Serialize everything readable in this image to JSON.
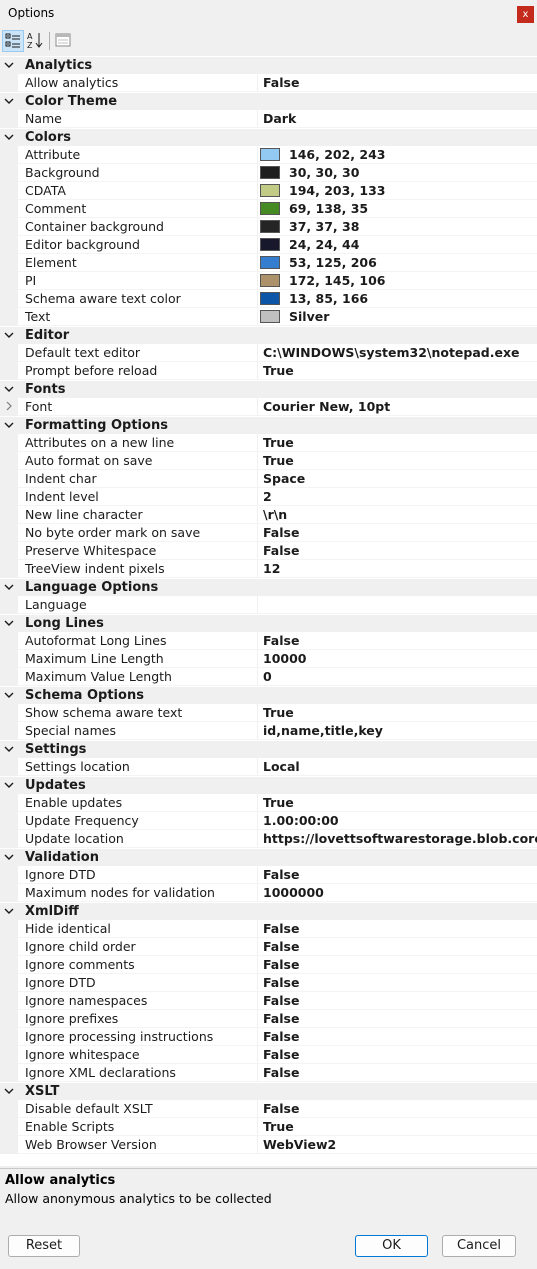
{
  "window": {
    "title": "Options",
    "close_glyph": "x"
  },
  "toolbar": {
    "buttons": [
      {
        "name": "categorized-view-icon",
        "active": true
      },
      {
        "name": "alphabetical-sort-icon",
        "active": false
      },
      {
        "name": "property-pages-icon",
        "active": false
      }
    ]
  },
  "grid": {
    "categories": [
      {
        "label": "Analytics",
        "props": [
          {
            "name": "Allow analytics",
            "value": "False"
          }
        ]
      },
      {
        "label": "Color Theme",
        "props": [
          {
            "name": "Name",
            "value": "Dark"
          }
        ]
      },
      {
        "label": "Colors",
        "props": [
          {
            "name": "Attribute",
            "value": "146, 202, 243",
            "color": "#92caf3"
          },
          {
            "name": "Background",
            "value": "30, 30, 30",
            "color": "#1e1e1e"
          },
          {
            "name": "CDATA",
            "value": "194, 203, 133",
            "color": "#c2cb85"
          },
          {
            "name": "Comment",
            "value": "69, 138, 35",
            "color": "#458a23"
          },
          {
            "name": "Container background",
            "value": "37, 37, 38",
            "color": "#252526"
          },
          {
            "name": "Editor background",
            "value": "24, 24, 44",
            "color": "#18182c"
          },
          {
            "name": "Element",
            "value": "53, 125, 206",
            "color": "#357dce"
          },
          {
            "name": "PI",
            "value": "172, 145, 106",
            "color": "#ac916a"
          },
          {
            "name": "Schema aware text color",
            "value": "13, 85, 166",
            "color": "#0d55a6"
          },
          {
            "name": "Text",
            "value": "Silver",
            "color": "#c0c0c0"
          }
        ]
      },
      {
        "label": "Editor",
        "props": [
          {
            "name": "Default text editor",
            "value": "C:\\WINDOWS\\system32\\notepad.exe"
          },
          {
            "name": "Prompt before reload",
            "value": "True"
          }
        ]
      },
      {
        "label": "Fonts",
        "props": [
          {
            "name": "Font",
            "value": "Courier New, 10pt",
            "expandable": true
          }
        ]
      },
      {
        "label": "Formatting Options",
        "props": [
          {
            "name": "Attributes on a new line",
            "value": "True"
          },
          {
            "name": "Auto format on save",
            "value": "True"
          },
          {
            "name": "Indent char",
            "value": "Space"
          },
          {
            "name": "Indent level",
            "value": "2"
          },
          {
            "name": "New line character",
            "value": "\\r\\n"
          },
          {
            "name": "No byte order mark on save",
            "value": "False"
          },
          {
            "name": "Preserve Whitespace",
            "value": "False"
          },
          {
            "name": "TreeView indent pixels",
            "value": "12"
          }
        ]
      },
      {
        "label": "Language Options",
        "props": [
          {
            "name": "Language",
            "value": ""
          }
        ]
      },
      {
        "label": "Long Lines",
        "props": [
          {
            "name": "Autoformat Long Lines",
            "value": "False"
          },
          {
            "name": "Maximum Line Length",
            "value": "10000"
          },
          {
            "name": "Maximum Value Length",
            "value": "0"
          }
        ]
      },
      {
        "label": "Schema Options",
        "props": [
          {
            "name": "Show schema aware text",
            "value": "True"
          },
          {
            "name": "Special names",
            "value": "id,name,title,key"
          }
        ]
      },
      {
        "label": "Settings",
        "props": [
          {
            "name": "Settings location",
            "value": "Local"
          }
        ]
      },
      {
        "label": "Updates",
        "props": [
          {
            "name": "Enable updates",
            "value": "True"
          },
          {
            "name": "Update Frequency",
            "value": "1.00:00:00"
          },
          {
            "name": "Update location",
            "value": "https://lovettsoftwarestorage.blob.core.w"
          }
        ]
      },
      {
        "label": "Validation",
        "props": [
          {
            "name": "Ignore DTD",
            "value": "False"
          },
          {
            "name": "Maximum nodes for validation",
            "value": "1000000"
          }
        ]
      },
      {
        "label": "XmlDiff",
        "props": [
          {
            "name": "Hide identical",
            "value": "False"
          },
          {
            "name": "Ignore child order",
            "value": "False"
          },
          {
            "name": "Ignore comments",
            "value": "False"
          },
          {
            "name": "Ignore DTD",
            "value": "False"
          },
          {
            "name": "Ignore namespaces",
            "value": "False"
          },
          {
            "name": "Ignore prefixes",
            "value": "False"
          },
          {
            "name": "Ignore processing instructions",
            "value": "False"
          },
          {
            "name": "Ignore whitespace",
            "value": "False"
          },
          {
            "name": "Ignore XML declarations",
            "value": "False"
          }
        ]
      },
      {
        "label": "XSLT",
        "props": [
          {
            "name": "Disable default XSLT",
            "value": "False"
          },
          {
            "name": "Enable Scripts",
            "value": "True"
          },
          {
            "name": "Web Browser Version",
            "value": "WebView2"
          }
        ]
      }
    ]
  },
  "description": {
    "title": "Allow analytics",
    "text": "Allow anonymous analytics to be collected"
  },
  "buttons": {
    "reset": "Reset",
    "ok": "OK",
    "cancel": "Cancel"
  },
  "colors": {
    "close": "#c42b1c",
    "default_button_border": "#0078d4",
    "active_tool": "#cce4f7"
  }
}
